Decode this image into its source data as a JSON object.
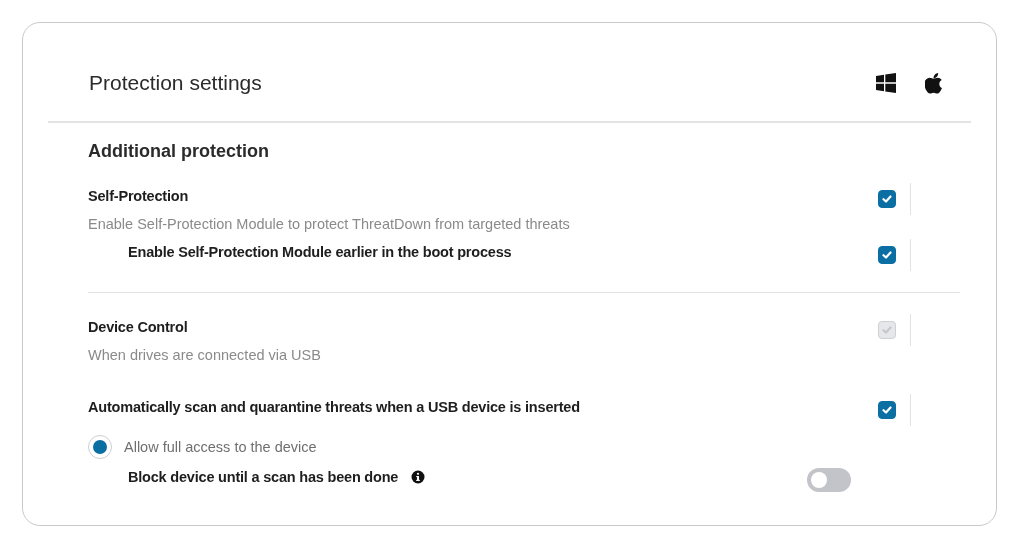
{
  "header": {
    "title": "Protection settings",
    "platforms": [
      {
        "kind": "windows"
      },
      {
        "kind": "apple"
      }
    ]
  },
  "section": {
    "title": "Additional protection"
  },
  "groups": [
    {
      "settings": [
        {
          "kind": "checkbox",
          "label": "Self-Protection",
          "description": "Enable Self-Protection Module to protect ThreatDown from targeted threats",
          "checked": true,
          "disabled": false,
          "children": [
            {
              "kind": "checkbox",
              "label": "Enable Self-Protection Module earlier in the boot process",
              "checked": true,
              "disabled": false
            }
          ]
        }
      ]
    },
    {
      "settings": [
        {
          "kind": "checkbox",
          "label": "Device Control",
          "description": "When drives are connected via USB",
          "checked": true,
          "disabled": true
        },
        {
          "kind": "checkbox",
          "label": "Automatically scan and quarantine threats when a USB device is inserted",
          "checked": true,
          "disabled": false,
          "children": [
            {
              "kind": "radio",
              "label": "Allow full access to the device",
              "selected": true
            },
            {
              "kind": "toggle",
              "label": "Block device until a scan has been done",
              "on": false,
              "info": true
            }
          ]
        }
      ]
    }
  ]
}
